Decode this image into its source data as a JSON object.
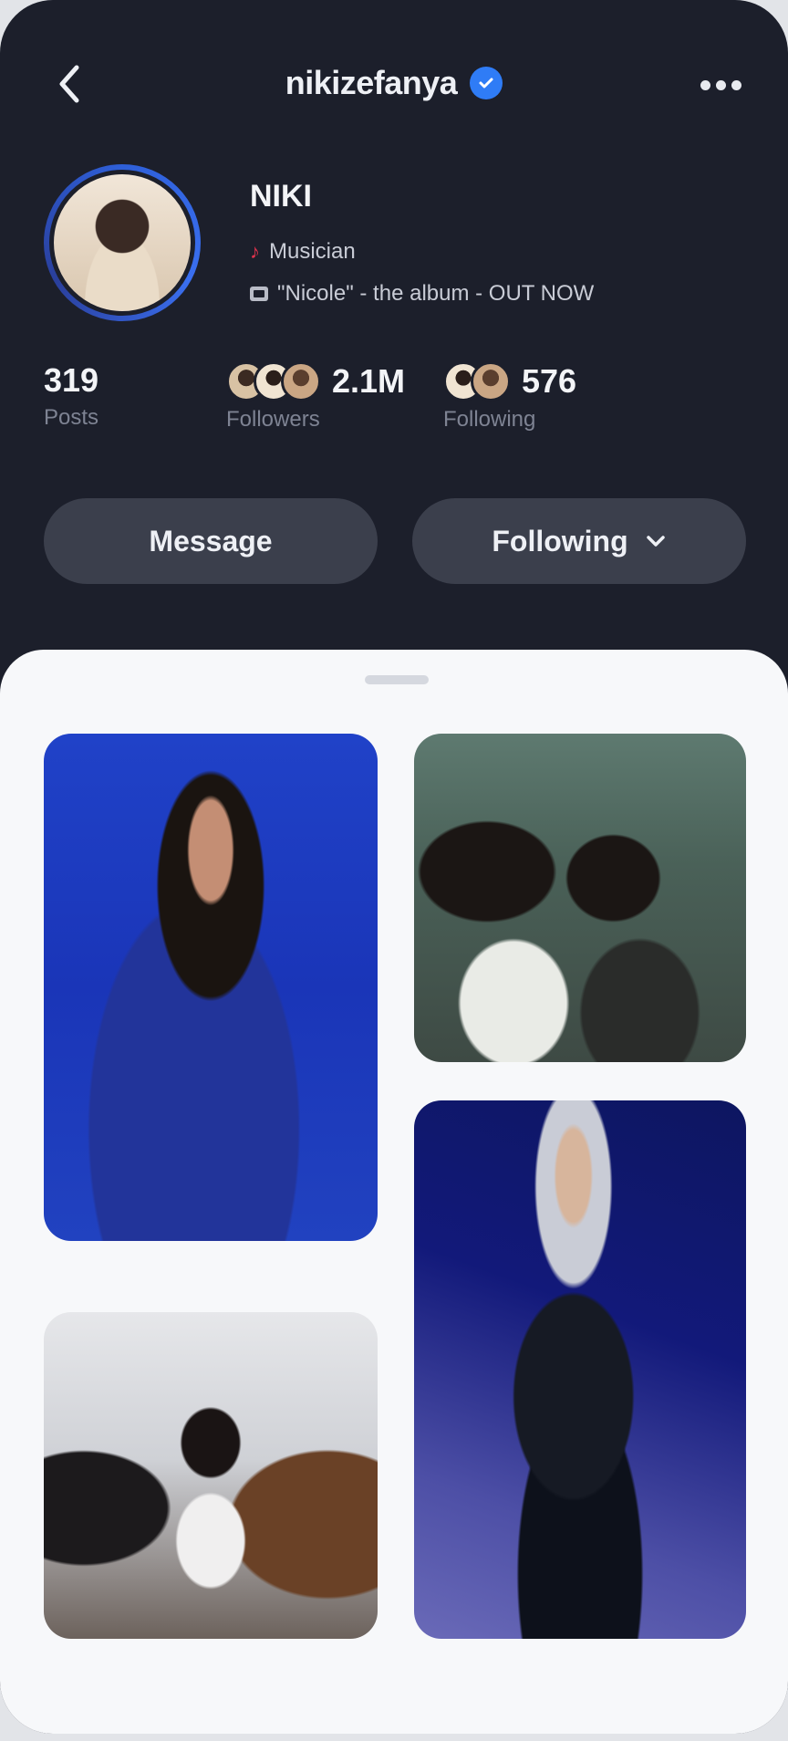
{
  "header": {
    "handle": "nikizefanya",
    "back_icon": "chevron-left-icon",
    "verified_icon": "verified-badge-icon",
    "more_icon": "more-horizontal-icon"
  },
  "profile": {
    "name": "NIKI",
    "bio_line1": "Musician",
    "bio_line2": "\"Nicole\" - the album - OUT NOW"
  },
  "stats": {
    "posts": {
      "value": "319",
      "label": "Posts"
    },
    "followers": {
      "value": "2.1M",
      "label": "Followers"
    },
    "following": {
      "value": "576",
      "label": "Following"
    }
  },
  "actions": {
    "message_label": "Message",
    "following_label": "Following",
    "dropdown_icon": "chevron-down-icon"
  },
  "colors": {
    "background": "#1c1f2b",
    "button": "#3b3f4c",
    "verified": "#2f7cf6",
    "sheet": "#f7f8fa"
  }
}
